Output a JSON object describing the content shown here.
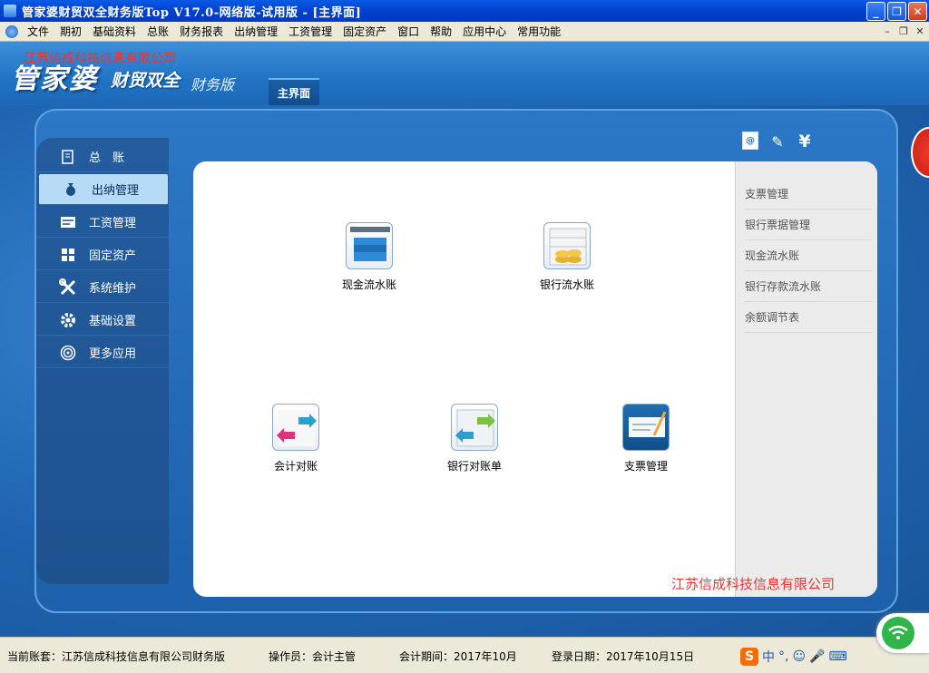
{
  "window": {
    "title": "管家婆财贸双全财务版Top V17.0-网络版-试用版 - [主界面]"
  },
  "menu": {
    "items": [
      "文件",
      "期初",
      "基础资料",
      "总账",
      "财务报表",
      "出纳管理",
      "工资管理",
      "固定资产",
      "窗口",
      "帮助",
      "应用中心",
      "常用功能"
    ]
  },
  "banner": {
    "company_overlay": "江苏信成科技信息有限公司",
    "logo_main": "管家婆",
    "logo_sub": "财贸双全",
    "logo_edition": "财务版",
    "active_tab": "主界面"
  },
  "sidebar": {
    "items": [
      {
        "label": "总　账",
        "icon": "ledger-icon"
      },
      {
        "label": "出纳管理",
        "icon": "money-bag-icon",
        "active": true
      },
      {
        "label": "工资管理",
        "icon": "salary-card-icon"
      },
      {
        "label": "固定资产",
        "icon": "grid-icon"
      },
      {
        "label": "系统维护",
        "icon": "tools-icon"
      },
      {
        "label": "基础设置",
        "icon": "gear-icon"
      },
      {
        "label": "更多应用",
        "icon": "target-icon"
      }
    ]
  },
  "toolbar": {
    "mail_glyph": "@",
    "edit_glyph": "✎",
    "yen_glyph": "¥"
  },
  "functions": [
    {
      "label": "现金流水账",
      "icon": "cash-journal-icon"
    },
    {
      "label": "银行流水账",
      "icon": "bank-journal-icon"
    },
    {
      "label": "会计对账",
      "icon": "account-reconcile-icon"
    },
    {
      "label": "银行对账单",
      "icon": "bank-statement-icon"
    },
    {
      "label": "支票管理",
      "icon": "check-management-icon"
    }
  ],
  "right_menu": {
    "items": [
      "支票管理",
      "银行票据管理",
      "现金流水账",
      "银行存款流水账",
      "余额调节表"
    ]
  },
  "footer_company": "江苏信成科技信息有限公司",
  "status": {
    "account_set": "当前账套：江苏信成科技信息有限公司财务版",
    "operator": "操作员：会计主管",
    "period": "会计期间：2017年10月",
    "login_date": "登录日期：2017年10月15日"
  },
  "ime": {
    "logo": "S",
    "mode": "中"
  }
}
